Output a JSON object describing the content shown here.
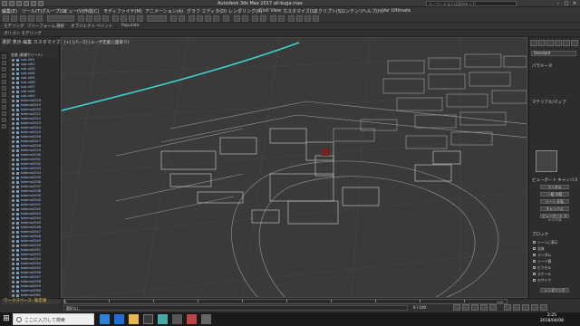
{
  "app": {
    "title": "Autodesk 3ds Max 2017    all-kuga.max",
    "search_box": "キーワードまたは語句を入力"
  },
  "menubar": {
    "items": [
      "編集(E)",
      "ツール(T)",
      "グループ(G)",
      "ビュー(V)",
      "作成(C)",
      "モディファイヤ(M)",
      "アニメーション(A)",
      "グラフ エディタ(D)",
      "レンダリング(R)",
      "Civil View",
      "カスタマイズ(U)",
      "スクリプト(S)",
      "コンテンツ",
      "ヘルプ(H)",
      "Var Ultimate"
    ]
  },
  "ribbon": {
    "labels": [
      "モデリング",
      "フリーフォーム",
      "選択",
      "オブジェクト ペイント",
      "Populate"
    ],
    "sub_label": "ポリゴン モデリング"
  },
  "scene_explorer": {
    "header": "選択   表示   編集   カスタマイズ",
    "column_header": "名前 (昇順でソート)",
    "items": [
      "sub-nl01",
      "sub-nl02",
      "sub-nl03",
      "sub-nl04",
      "sub-nl05",
      "sub-nl06",
      "sub-nl07",
      "sub-nl08",
      "sub-nl09",
      "tatemo2018",
      "tatemo2019",
      "tatemo2020",
      "tatemo2021",
      "tatemo2022",
      "tatemo2023",
      "tatemo2024",
      "tatemo2025",
      "tatemo2026",
      "tatemo2027",
      "tatemo2028",
      "tatemo2029",
      "tatemo2030",
      "tatemo2031",
      "tatemo2032",
      "tatemo2033",
      "tatemo2034",
      "tatemo2035",
      "tatemo2036",
      "tatemo2037",
      "tatemo2038",
      "tatemo2039",
      "tatemo2040",
      "tatemo2041",
      "tatemo2042",
      "tatemo2043",
      "tatemo2044",
      "tatemo2045",
      "tatemo2046",
      "tatemo2047",
      "tatemo2048",
      "tatemo2049",
      "tatemo2050",
      "tatemo2051",
      "tatemo2052",
      "tatemo2053",
      "tatemo2054",
      "tatemo2055",
      "tatemo2056",
      "tatemo2057",
      "tatemo2058",
      "tatemo2059",
      "tatemo2060",
      "tatemo2061"
    ]
  },
  "viewport": {
    "label": "[+] [パース] [ユーザ定義] [面取り]"
  },
  "command_panel": {
    "name_field": "Standard",
    "sections": [
      "パラメータ",
      "マテリアル/マップ",
      "ビューポート キャンバス",
      "ブロック"
    ],
    "buttons": [
      "ランダム",
      "一般 分割",
      "シーン 反転",
      "キャンバス",
      "ビューポート キャンバス",
      "レンダリング"
    ],
    "checks": [
      "シーンに表示",
      "全体",
      "ランダム",
      "シード値",
      "ピクセル",
      "スケール",
      "モザイク"
    ]
  },
  "bottom": {
    "workspace": "ワークスペース: 既定値",
    "timeline_start": "0",
    "timeline_end": "100",
    "frame": "0 / 100",
    "status": "選択なし"
  },
  "taskbar": {
    "search_placeholder": "ここに入力して検索",
    "time": "2:25",
    "date": "2018/04/08"
  }
}
